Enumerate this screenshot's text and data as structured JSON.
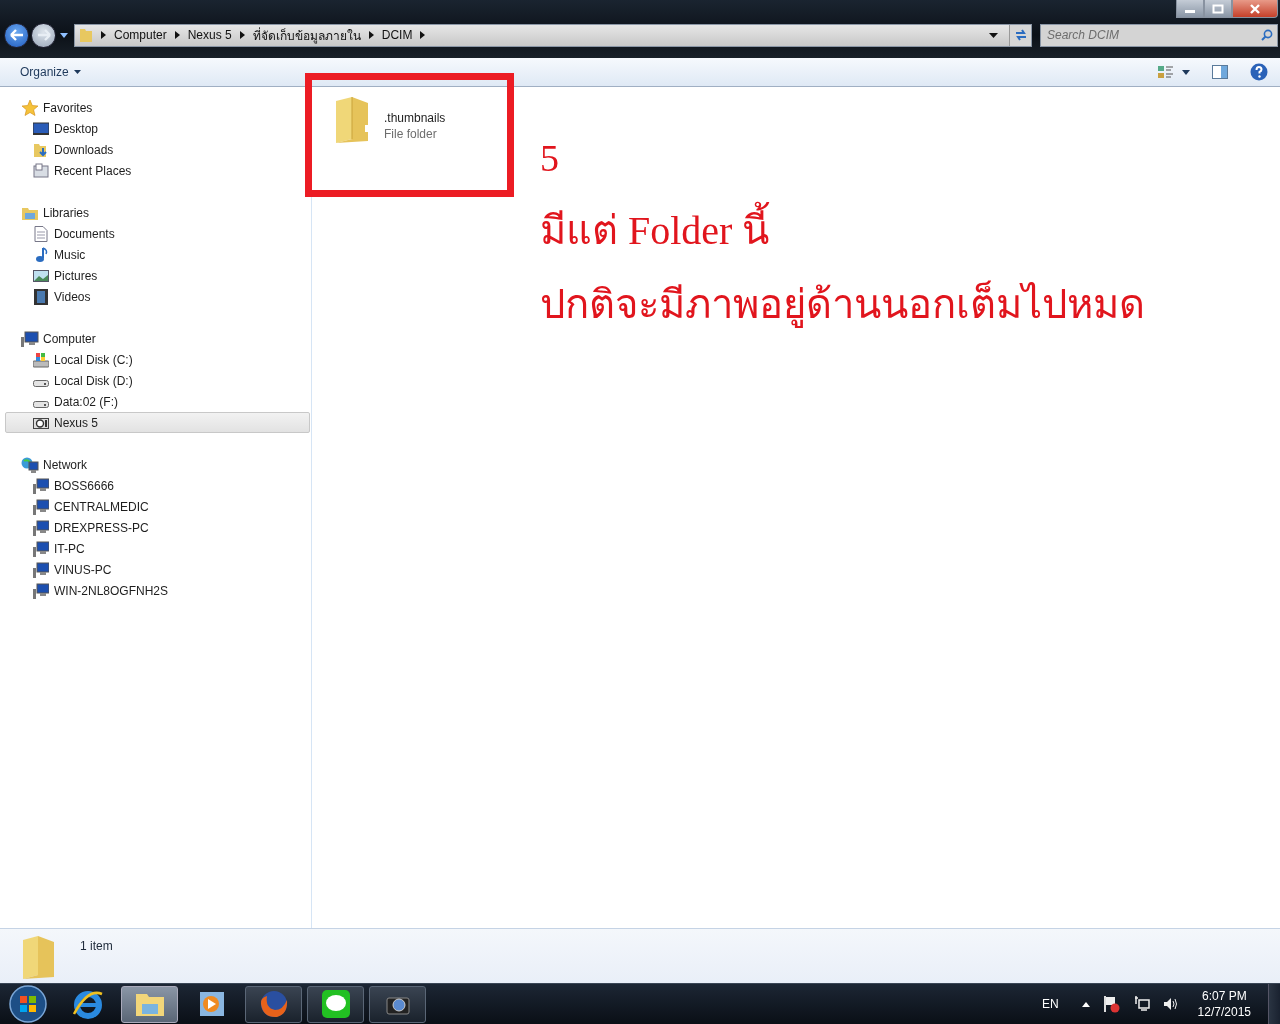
{
  "address_bar": {
    "crumbs": [
      "Computer",
      "Nexus 5",
      "ที่จัดเก็บข้อมูลภายใน",
      "DCIM"
    ]
  },
  "search": {
    "placeholder": "Search DCIM"
  },
  "toolbar": {
    "organize": "Organize"
  },
  "sidebar": {
    "groups": [
      {
        "label": "Favorites",
        "kind": "star",
        "selected": false,
        "children": [
          {
            "label": "Desktop",
            "kind": "desktop",
            "selected": false
          },
          {
            "label": "Downloads",
            "kind": "downloads",
            "selected": false
          },
          {
            "label": "Recent Places",
            "kind": "recent",
            "selected": false
          }
        ]
      },
      {
        "label": "Libraries",
        "kind": "library",
        "selected": false,
        "children": [
          {
            "label": "Documents",
            "kind": "document",
            "selected": false
          },
          {
            "label": "Music",
            "kind": "music",
            "selected": false
          },
          {
            "label": "Pictures",
            "kind": "pictures",
            "selected": false
          },
          {
            "label": "Videos",
            "kind": "video",
            "selected": false
          }
        ]
      },
      {
        "label": "Computer",
        "kind": "computer",
        "selected": false,
        "children": [
          {
            "label": "Local Disk (C:)",
            "kind": "system-disk",
            "selected": false
          },
          {
            "label": "Local Disk (D:)",
            "kind": "disk",
            "selected": false
          },
          {
            "label": "Data:02 (F:)",
            "kind": "disk",
            "selected": false
          },
          {
            "label": "Nexus 5",
            "kind": "camera",
            "selected": true
          }
        ]
      },
      {
        "label": "Network",
        "kind": "network",
        "selected": false,
        "children": [
          {
            "label": "BOSS6666",
            "kind": "computer",
            "selected": false
          },
          {
            "label": "CENTRALMEDIC",
            "kind": "computer",
            "selected": false
          },
          {
            "label": "DREXPRESS-PC",
            "kind": "computer",
            "selected": false
          },
          {
            "label": "IT-PC",
            "kind": "computer",
            "selected": false
          },
          {
            "label": "VINUS-PC",
            "kind": "computer",
            "selected": false
          },
          {
            "label": "WIN-2NL8OGFNH2S",
            "kind": "computer",
            "selected": false
          }
        ]
      }
    ]
  },
  "files": [
    {
      "name": ".thumbnails",
      "type": "File folder"
    }
  ],
  "annotations": {
    "number": "5",
    "lines": [
      "มีแต่ Folder นี้",
      "ปกติจะมีภาพอยู่ด้านนอกเต็มไปหมด"
    ]
  },
  "details_pane": {
    "count": "1 item"
  },
  "taskbar": {
    "apps": [
      {
        "kind": "browser-e",
        "running": false,
        "active": false
      },
      {
        "kind": "folder",
        "running": true,
        "active": true
      },
      {
        "kind": "media",
        "running": false,
        "active": false
      },
      {
        "kind": "fox",
        "running": true,
        "active": false
      },
      {
        "kind": "chat",
        "running": true,
        "active": false
      },
      {
        "kind": "camera",
        "running": true,
        "active": false
      }
    ],
    "tray": {
      "language": "EN",
      "time": "6:07 PM",
      "date": "12/7/2015"
    }
  }
}
